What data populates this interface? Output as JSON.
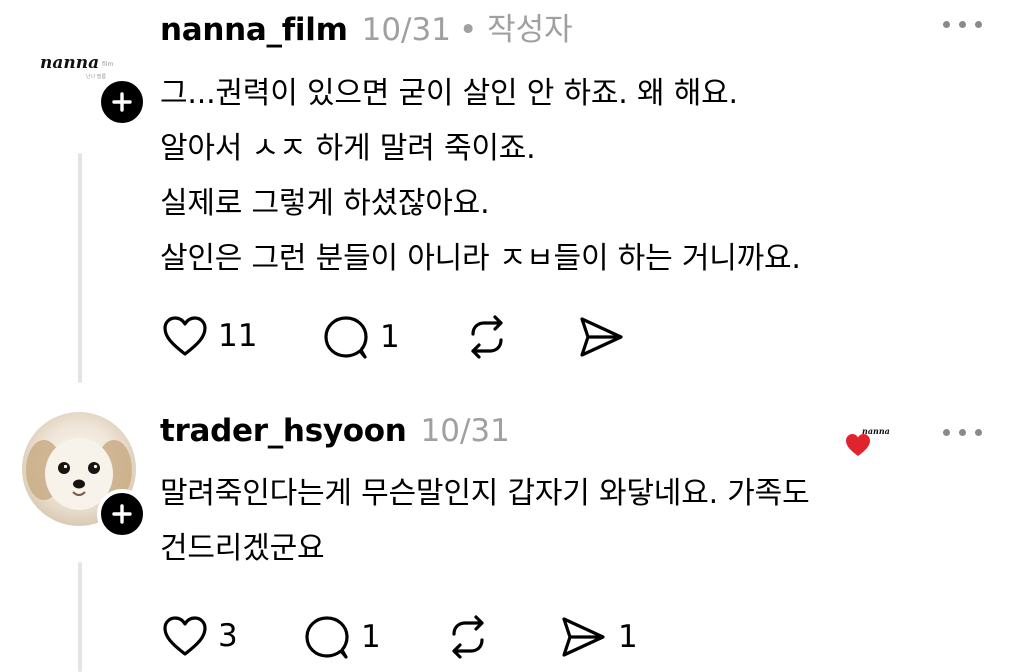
{
  "post1": {
    "username": "nanna_film",
    "date": "10/31",
    "badge": "• 작성자",
    "avatar_logo_text": "nanna",
    "lines": [
      "그...권력이 있으면 굳이 살인 안 하죠. 왜 해요.",
      "알아서 ㅅㅈ 하게 말려 죽이죠.",
      "실제로 그렇게 하셨잖아요.",
      "살인은 그런 분들이 아니라 ㅈㅂ들이 하는 거니까요."
    ],
    "likes": "11",
    "replies": "1",
    "reposts": "",
    "shares": ""
  },
  "post2": {
    "username": "trader_hsyoon",
    "date": "10/31",
    "lines": [
      "말려죽인다는게 무슨말인지 갑자기 와닿네요. 가족도",
      "건드리겠군요"
    ],
    "likes": "3",
    "replies": "1",
    "reposts": "",
    "shares": "1",
    "liked_by_author_logo_text": "nanna"
  },
  "colors": {
    "text": "#000000",
    "muted": "#a0a0a0",
    "heart_liked": "#e0242e",
    "logo_gold": "#e8c840"
  },
  "icons": [
    "heart-icon",
    "comment-icon",
    "repost-icon",
    "share-icon",
    "plus-icon",
    "more-icon"
  ]
}
